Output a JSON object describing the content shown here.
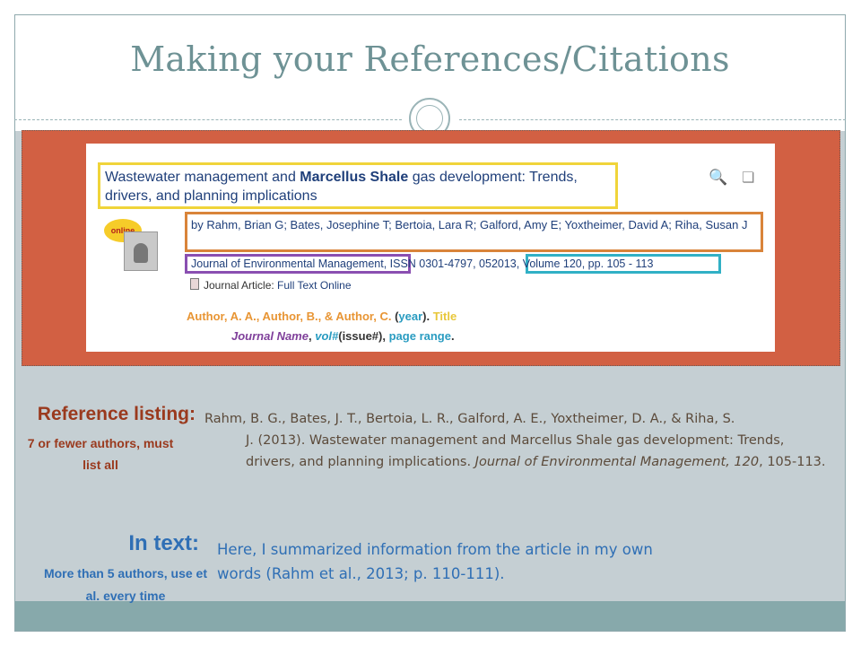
{
  "title": "Making your References/Citations",
  "screenshot": {
    "article_title_pre": "Wastewater management and ",
    "article_title_bold": "Marcellus Shale",
    "article_title_post": " gas development: Trends, drivers, and planning implications",
    "authors": "by Rahm, Brian G; Bates, Josephine T; Bertoia, Lara R; Galford, Amy E; Yoxtheimer, David A; Riha, Susan J",
    "journal": "Journal of Environmental Management",
    "source_issn": ", ISSN 0301-4797, 05",
    "source_volume": "2013, Volume 120, pp. 105 - 113",
    "article_type": "Journal Article:",
    "full_text": "Full Text Online",
    "online_badge": "online",
    "apa": {
      "authors": "Author, A. A., Author, B., & Author, C.",
      "year_open": " (",
      "year": "year",
      "year_close": "). ",
      "title": "Title",
      "journal": "Journal Name",
      "comma1": ", ",
      "vol": "vol#",
      "issue": "(issue#)",
      "comma2": ", ",
      "pages": "page range",
      "period": "."
    }
  },
  "reference": {
    "heading": "Reference listing:",
    "note": "7 or fewer authors, must list all",
    "line1": "Rahm, B. G., Bates, J. T., Bertoia, L. R., Galford, A. E., Yoxtheimer, D. A., & Riha, S.",
    "line2_pre": "J. (2013). Wastewater management and Marcellus Shale gas development: Trends, drivers, and planning implications. ",
    "journal": "Journal of Environmental Management, 120",
    "line2_post": ", 105-113."
  },
  "intext": {
    "heading": "In text:",
    "note": "More than 5 authors, use et al. every time",
    "text": "Here, I summarized information from the article in my own words (Rahm et al., 2013; p. 110-111)."
  },
  "colors": {
    "title": "#6e9295",
    "panel": "#d26043",
    "body_bg": "#c5cfd3",
    "reference_heading": "#9a3a1e",
    "intext": "#2f6fb5"
  },
  "icons": [
    "search-icon",
    "cite-icon",
    "document-icon"
  ]
}
